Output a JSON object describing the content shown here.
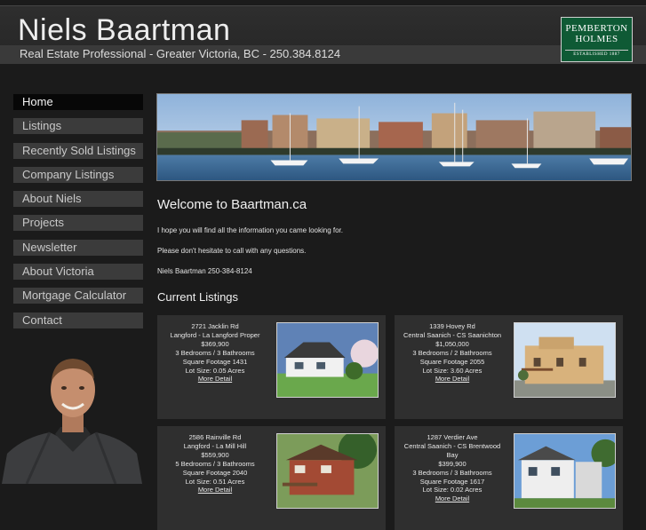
{
  "header": {
    "site_name": "Niels Baartman",
    "tagline": "Real Estate Professional - Greater Victoria, BC - 250.384.8124",
    "logo_line1": "PEMBERTON",
    "logo_line2": "HOLMES",
    "logo_line3": "ESTABLISHED 1887"
  },
  "nav": {
    "items": [
      {
        "label": "Home"
      },
      {
        "label": "Listings"
      },
      {
        "label": "Recently Sold Listings"
      },
      {
        "label": "Company Listings"
      },
      {
        "label": "About Niels"
      },
      {
        "label": "Projects"
      },
      {
        "label": "Newsletter"
      },
      {
        "label": "About Victoria"
      },
      {
        "label": "Mortgage Calculator"
      },
      {
        "label": "Contact"
      }
    ]
  },
  "main": {
    "welcome_title": "Welcome to Baartman.ca",
    "para1": "I hope you will find all the information you came looking for.",
    "para2": "Please don't hesitate to call with any questions.",
    "para3": "Niels Baartman 250-384-8124",
    "current_listings_title": "Current Listings"
  },
  "listings": [
    {
      "address": "2721 Jacklin Rd",
      "area": "Langford - La Langford Proper",
      "price": "$369,900",
      "rooms": "3 Bedrooms / 3 Bathrooms",
      "sqft": "Square Footage 1431",
      "lot": "Lot Size: 0.05 Acres",
      "more": "More Detail"
    },
    {
      "address": "1339 Hovey Rd",
      "area": "Central Saanich - CS Saanichton",
      "price": "$1,050,000",
      "rooms": "3 Bedrooms / 2 Bathrooms",
      "sqft": "Square Footage 2055",
      "lot": "Lot Size: 3.60 Acres",
      "more": "More Detail"
    },
    {
      "address": "2586 Rainville Rd",
      "area": "Langford - La Mill Hill",
      "price": "$559,900",
      "rooms": "5 Bedrooms / 3 Bathrooms",
      "sqft": "Square Footage 2040",
      "lot": "Lot Size: 0.51 Acres",
      "more": "More Detail"
    },
    {
      "address": "1287 Verdier Ave",
      "area": "Central Saanich - CS Brentwood Bay",
      "price": "$399,900",
      "rooms": "3 Bedrooms / 3 Bathrooms",
      "sqft": "Square Footage 1617",
      "lot": "Lot Size: 0.02 Acres",
      "more": "More Detail"
    }
  ]
}
